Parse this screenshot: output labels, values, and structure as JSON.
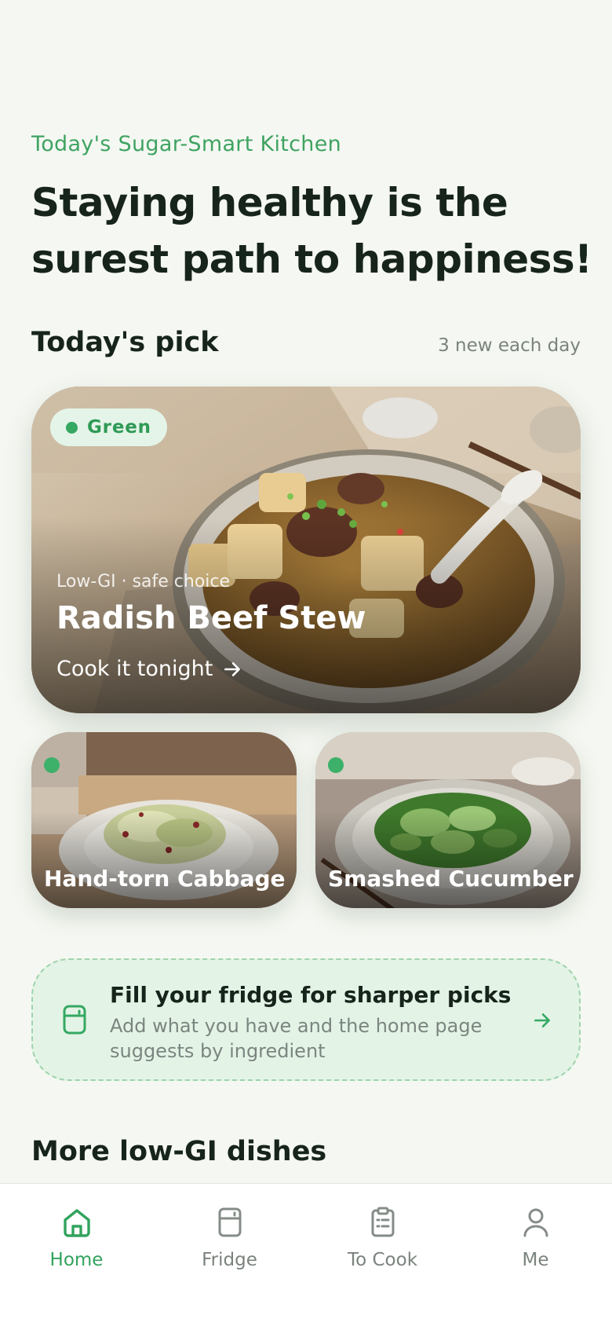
{
  "header": {
    "kicker": "Today's Sugar-Smart Kitchen",
    "title": "Staying healthy is the surest path to happiness!"
  },
  "todays_pick": {
    "title": "Today's pick",
    "note": "3 new each day"
  },
  "featured": {
    "badge": "Green",
    "subtitle": "Low-GI · safe choice",
    "name": "Radish Beef Stew",
    "cta": "Cook it tonight"
  },
  "minis": [
    {
      "name": "Hand-torn Cabbage"
    },
    {
      "name": "Smashed Cucumber"
    }
  ],
  "fridge_prompt": {
    "title": "Fill your fridge for sharper picks",
    "subtitle": "Add what you have and the home page suggests by ingredient"
  },
  "more_section": {
    "title": "More low-GI dishes"
  },
  "nav": {
    "items": [
      {
        "label": "Home",
        "icon": "home-icon",
        "active": true
      },
      {
        "label": "Fridge",
        "icon": "fridge-icon",
        "active": false
      },
      {
        "label": "To Cook",
        "icon": "clipboard-icon",
        "active": false
      },
      {
        "label": "Me",
        "icon": "person-icon",
        "active": false
      }
    ]
  },
  "colors": {
    "accent": "#35a862",
    "background": "#f5f8f2",
    "text": "#17241b",
    "muted": "#7a837c"
  }
}
